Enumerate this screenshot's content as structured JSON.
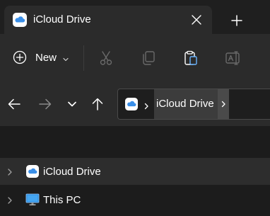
{
  "tab": {
    "title": "iCloud Drive",
    "icon": "icloud-icon"
  },
  "toolbar": {
    "new_label": "New",
    "icons": [
      "cut-icon",
      "copy-icon",
      "paste-icon",
      "rename-icon"
    ]
  },
  "address": {
    "root_icon": "icloud-icon",
    "current": "iCloud Drive"
  },
  "nav_pane": {
    "items": [
      {
        "label": "iCloud Drive",
        "icon": "icloud-icon",
        "selected": true
      },
      {
        "label": "This PC",
        "icon": "monitor-icon",
        "selected": false
      }
    ]
  },
  "colors": {
    "background": "#1c1c1c",
    "toolbar": "#2b2b2b",
    "selected": "#2d2d2d",
    "icloud_blue": "#3a8fe8"
  }
}
